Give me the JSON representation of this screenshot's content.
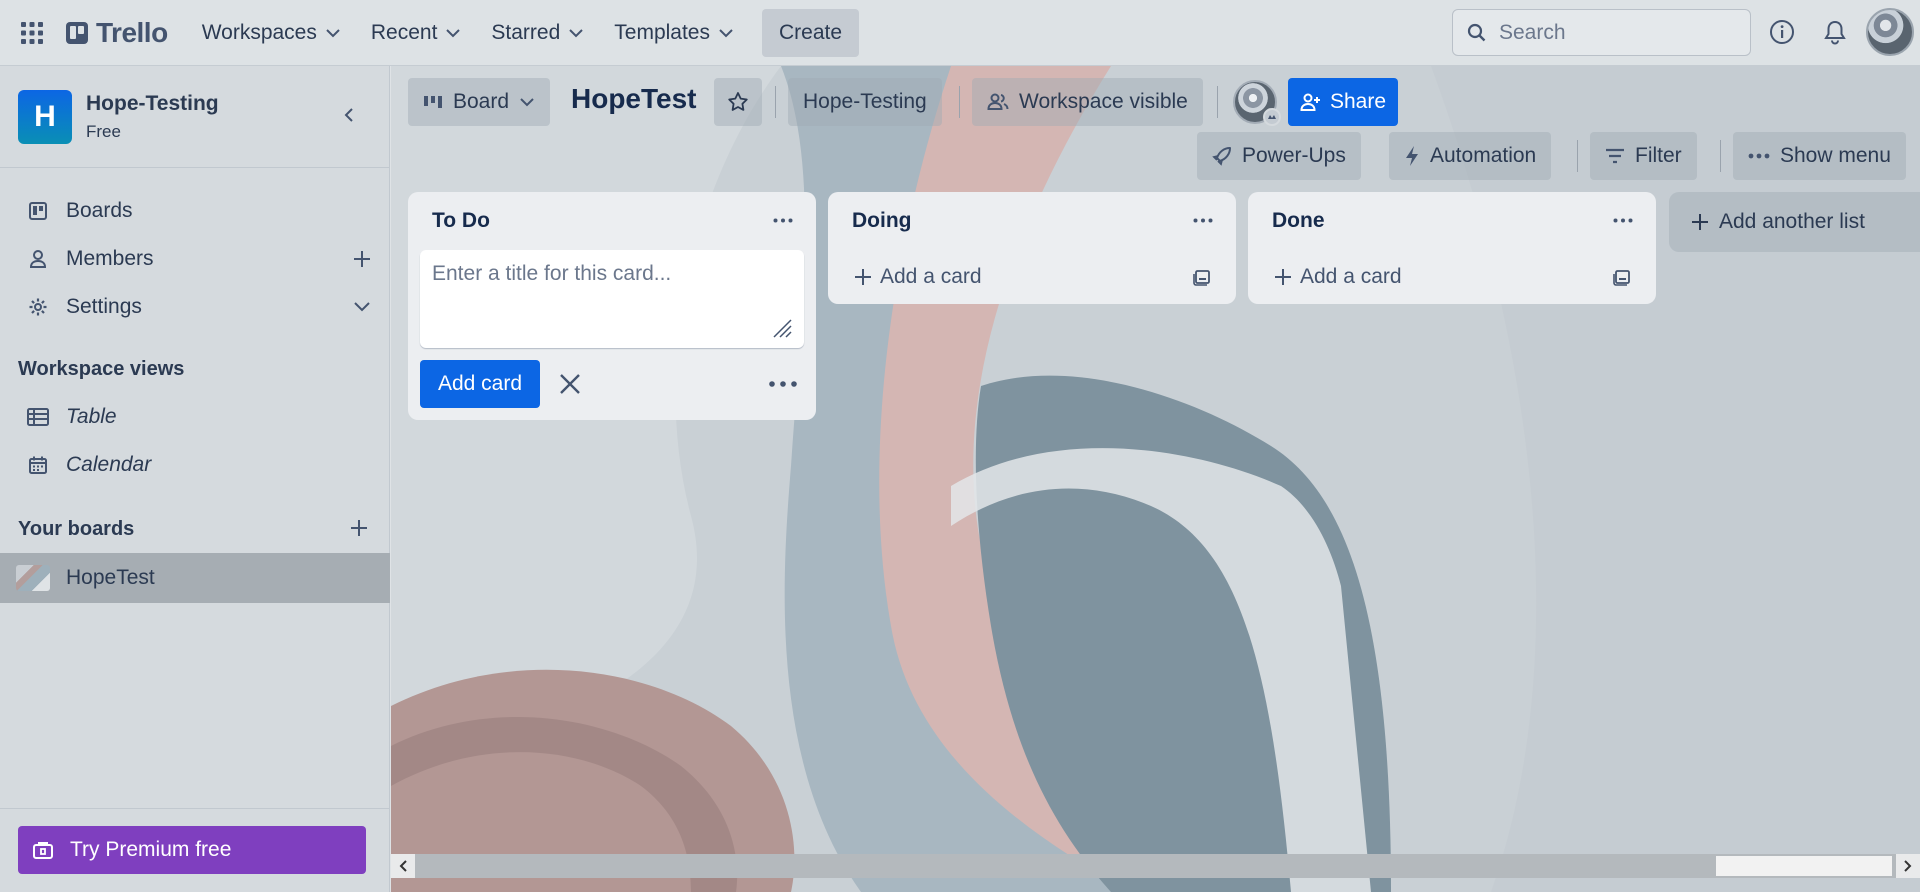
{
  "topnav": {
    "logo": "Trello",
    "items": [
      {
        "label": "Workspaces"
      },
      {
        "label": "Recent"
      },
      {
        "label": "Starred"
      },
      {
        "label": "Templates"
      }
    ],
    "create": "Create",
    "search_placeholder": "Search"
  },
  "sidebar": {
    "workspace": {
      "initial": "H",
      "name": "Hope-Testing",
      "plan": "Free"
    },
    "nav": [
      {
        "label": "Boards",
        "icon": "board-icon"
      },
      {
        "label": "Members",
        "icon": "person-icon"
      },
      {
        "label": "Settings",
        "icon": "gear-icon"
      }
    ],
    "views_heading": "Workspace views",
    "views": [
      {
        "label": "Table",
        "icon": "table-icon"
      },
      {
        "label": "Calendar",
        "icon": "calendar-icon"
      }
    ],
    "your_boards_heading": "Your boards",
    "boards": [
      {
        "label": "HopeTest"
      }
    ],
    "premium": "Try Premium free"
  },
  "board": {
    "view": "Board",
    "title": "HopeTest",
    "workspace": "Hope-Testing",
    "visibility": "Workspace visible",
    "share": "Share",
    "powerups": "Power-Ups",
    "automation": "Automation",
    "filter": "Filter",
    "show_menu": "Show menu",
    "add_list": "Add another list"
  },
  "lists": [
    {
      "title": "To Do",
      "composer_placeholder": "Enter a title for this card...",
      "add_card_button": "Add card"
    },
    {
      "title": "Doing",
      "add_card": "Add a card"
    },
    {
      "title": "Done",
      "add_card": "Add a card"
    }
  ],
  "colors": {
    "accent": "#0c66e4",
    "premium": "#7f3fbf"
  }
}
